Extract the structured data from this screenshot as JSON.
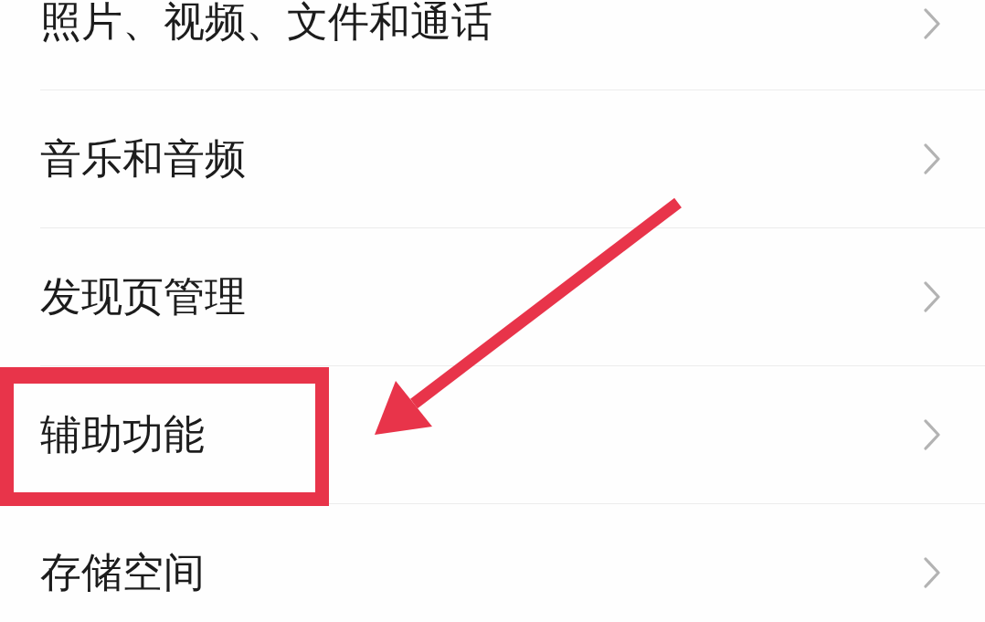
{
  "items": [
    {
      "label": "照片、视频、文件和通话",
      "highlighted": false
    },
    {
      "label": "音乐和音频",
      "highlighted": false
    },
    {
      "label": "发现页管理",
      "highlighted": false
    },
    {
      "label": "辅助功能",
      "highlighted": true
    },
    {
      "label": "存储空间",
      "highlighted": false
    }
  ]
}
